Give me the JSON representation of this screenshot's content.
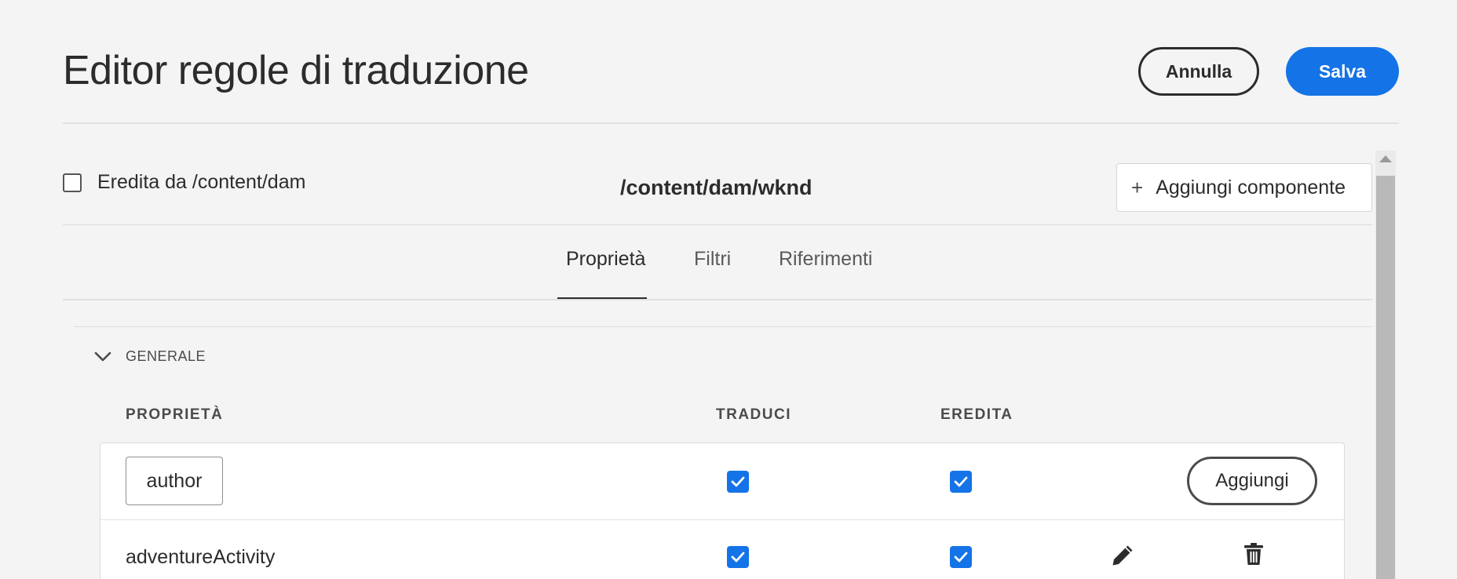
{
  "header": {
    "title": "Editor regole di traduzione",
    "cancel_label": "Annulla",
    "save_label": "Salva"
  },
  "toolbar": {
    "inherit_checked": false,
    "inherit_label": "Eredita da /content/dam",
    "path": "/content/dam/wknd",
    "add_component_label": "Aggiungi componente",
    "add_component_icon": "plus-icon"
  },
  "tabs": [
    {
      "label": "Proprietà",
      "active": true
    },
    {
      "label": "Filtri",
      "active": false
    },
    {
      "label": "Riferimenti",
      "active": false
    }
  ],
  "section": {
    "label": "GENERALE",
    "expanded": true,
    "icon": "chevron-down-icon"
  },
  "table": {
    "columns": [
      "PROPRIETÀ",
      "TRADUCI",
      "EREDITA"
    ],
    "new_row": {
      "property_value": "author",
      "translate": true,
      "inherit": true,
      "add_label": "Aggiungi"
    },
    "rows": [
      {
        "property": "adventureActivity",
        "translate": true,
        "inherit": true,
        "edit_icon": "pencil-icon",
        "delete_icon": "trash-icon"
      }
    ]
  },
  "colors": {
    "accent": "#1473e6",
    "background": "#f4f4f4",
    "text": "#2c2c2c"
  }
}
